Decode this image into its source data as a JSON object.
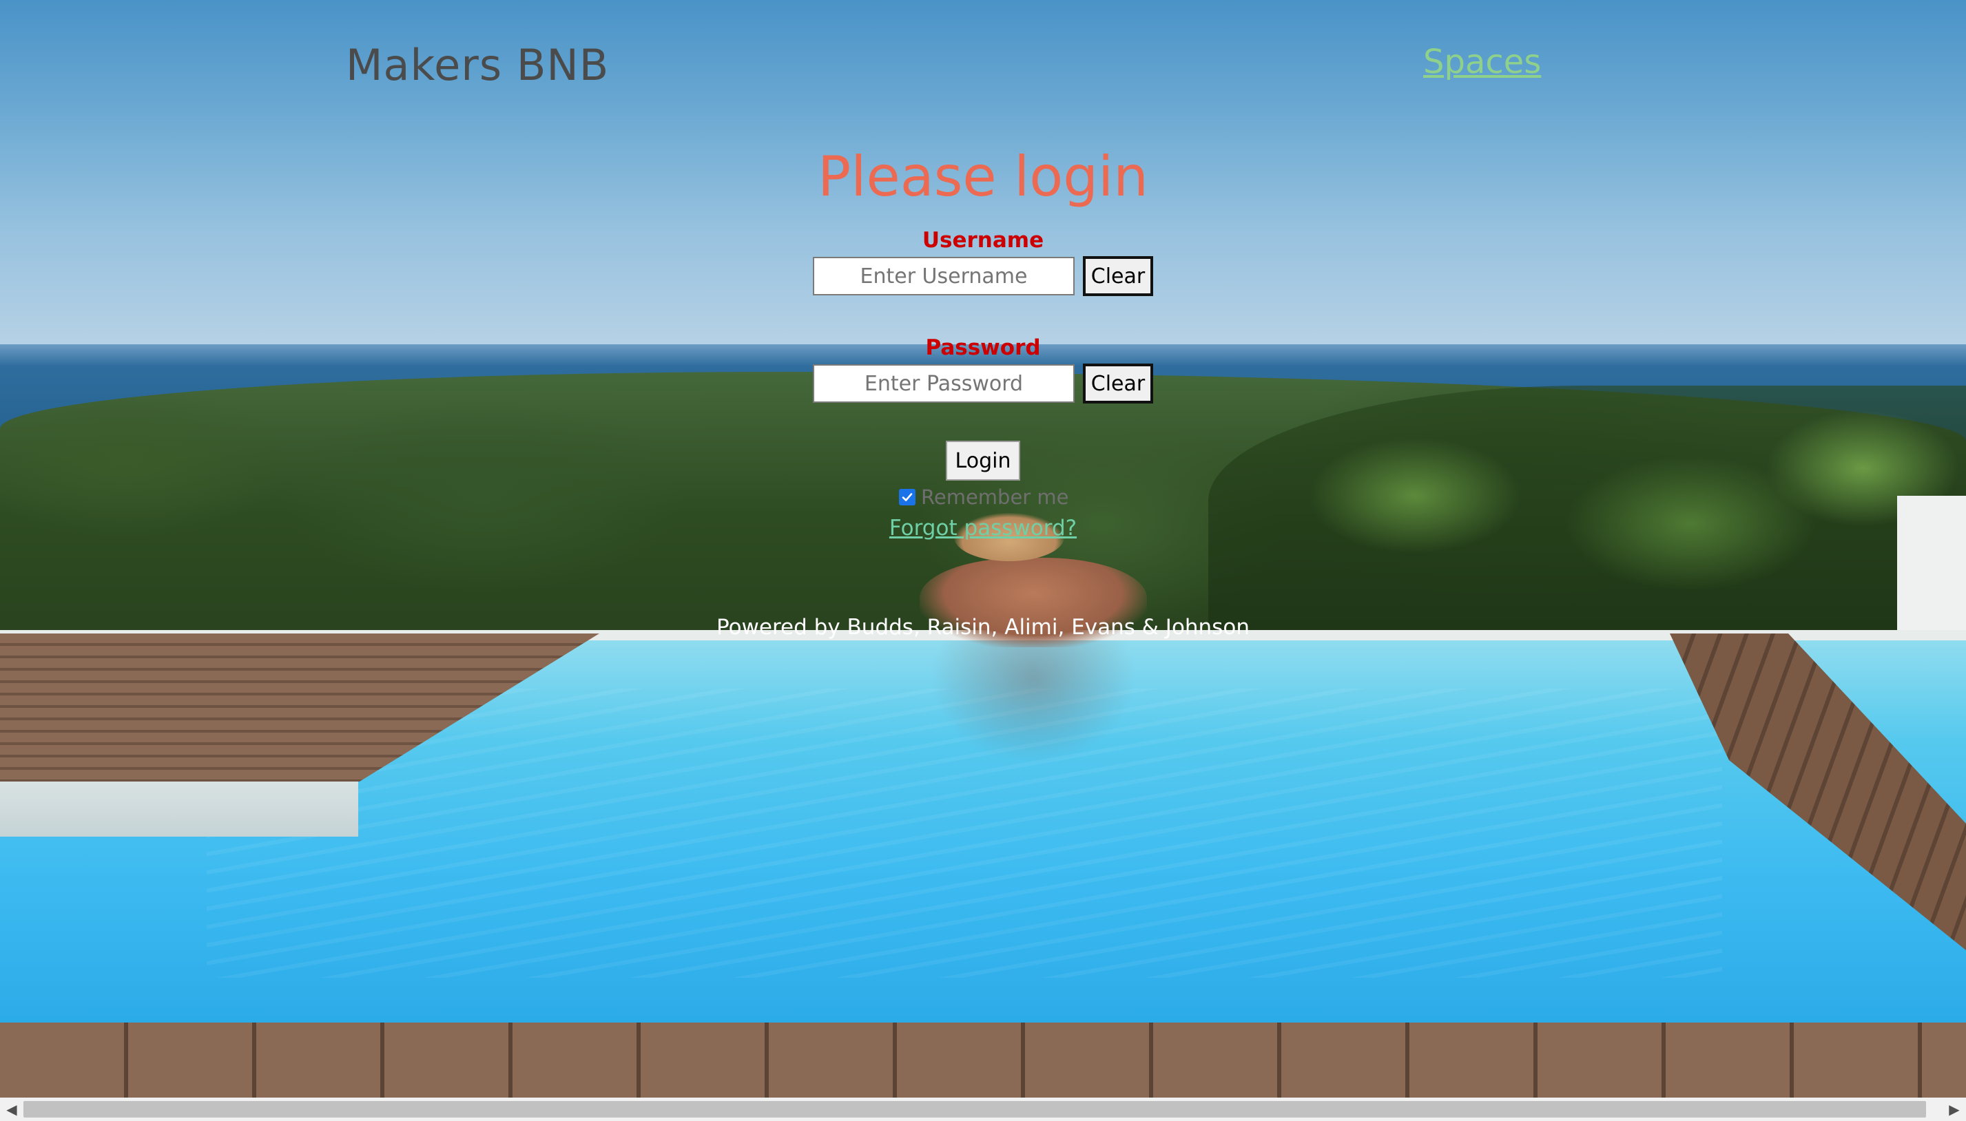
{
  "header": {
    "brand": "Makers BNB",
    "nav_link": "Spaces"
  },
  "login": {
    "title": "Please login",
    "username": {
      "label": "Username",
      "placeholder": "Enter Username",
      "value": "",
      "clear_label": "Clear"
    },
    "password": {
      "label": "Password",
      "placeholder": "Enter Password",
      "value": "",
      "clear_label": "Clear"
    },
    "submit_label": "Login",
    "remember_label": "Remember me",
    "remember_checked": true,
    "forgot_label": "Forgot password?"
  },
  "footer": {
    "text": "Powered by Budds, Raisin, Alimi, Evans & Johnson"
  },
  "scrollbar": {
    "left_arrow": "left-arrow-icon",
    "right_arrow": "right-arrow-icon"
  },
  "colors": {
    "title": "#ec6a52",
    "label": "#cc0000",
    "nav_link": "#8fd18a",
    "forgot_link": "#6fd0a8",
    "brand": "#4b4b4b"
  }
}
